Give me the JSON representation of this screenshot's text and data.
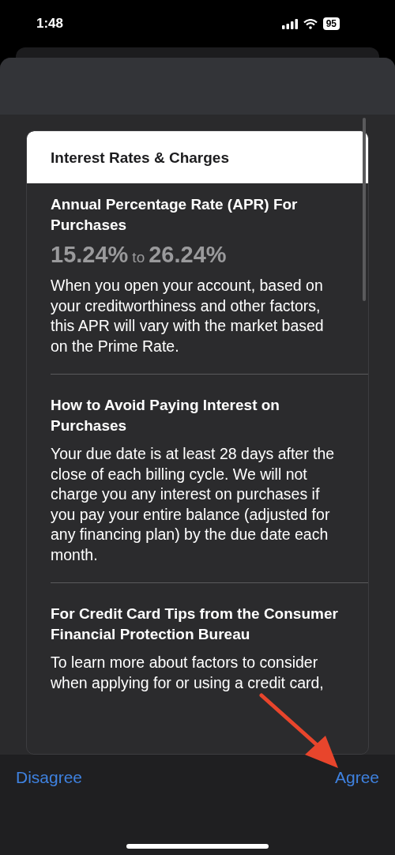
{
  "status_bar": {
    "time": "1:48",
    "battery": "95"
  },
  "sheet": {
    "card_title": "Interest Rates & Charges",
    "sections": [
      {
        "kind": "rate",
        "heading": "Annual Percentage Rate (APR) For Purchases",
        "rate_low": "15.24%",
        "rate_joiner": "to",
        "rate_high": "26.24%",
        "body": "When you open your account, based on your creditworthiness and other factors, this APR will vary with the market based on the Prime Rate."
      },
      {
        "kind": "text",
        "heading": "How to Avoid Paying Interest on Purchases",
        "body": "Your due date is at least 28 days after the close of each billing cycle. We will not charge you any interest on purchases if you pay your entire balance (adjusted for any financing plan) by the due date each month."
      },
      {
        "kind": "text",
        "heading": "For Credit Card Tips from the Consumer Financial Protection Bureau",
        "body": "To learn more about factors to consider when applying for or using a credit card,"
      }
    ]
  },
  "buttons": [
    {
      "label": "Disagree"
    },
    {
      "label": "Agree"
    }
  ]
}
